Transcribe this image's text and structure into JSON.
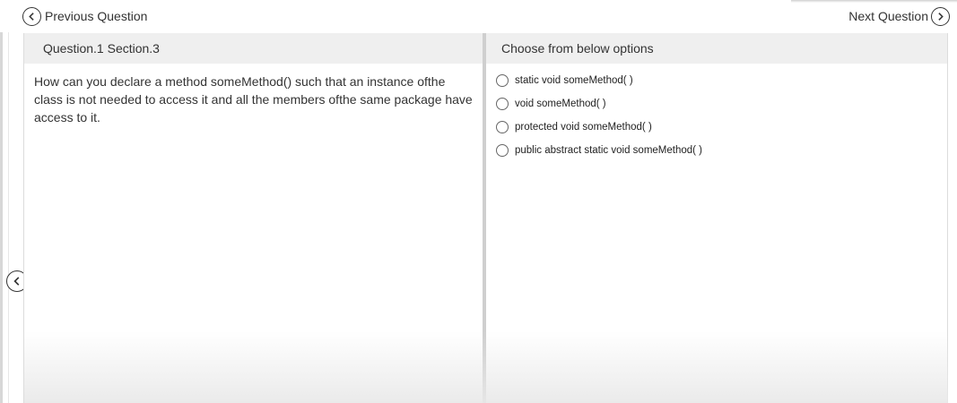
{
  "nav": {
    "previous_label": "Previous Question",
    "next_label": "Next Question"
  },
  "question_panel": {
    "header": "Question.1 Section.3",
    "text": "How can you declare a method someMethod() such that an instance ofthe class is not needed to access it and all the members ofthe same package have access to it."
  },
  "options_panel": {
    "header": "Choose from below options",
    "options": [
      {
        "label": "static void someMethod( )",
        "selected": false
      },
      {
        "label": "void someMethod( )",
        "selected": false
      },
      {
        "label": "protected void someMethod( )",
        "selected": false
      },
      {
        "label": "public abstract static void someMethod( )",
        "selected": false
      }
    ]
  },
  "icons": {
    "prev": "chevron-left-circle-icon",
    "next": "chevron-right-circle-icon",
    "side_back": "chevron-left-circle-icon"
  }
}
